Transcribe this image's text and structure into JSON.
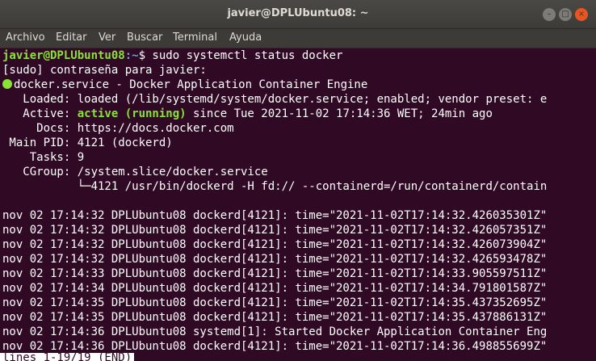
{
  "window": {
    "title": "javier@DPLUbuntu08: ~",
    "min_glyph": "–",
    "max_glyph": "□",
    "close_glyph": "×"
  },
  "menu": [
    "Archivo",
    "Editar",
    "Ver",
    "Buscar",
    "Terminal",
    "Ayuda"
  ],
  "terminal": {
    "prompt_user": "javier@DPLUbuntu08",
    "prompt_path": ":~",
    "prompt_cmd": "$ sudo systemctl status docker",
    "sudo_prompt": "[sudo] contraseña para javier:",
    "service_line": "docker.service - Docker Application Container Engine",
    "loaded": "   Loaded: loaded (/lib/systemd/system/docker.service; enabled; vendor preset: e",
    "active_label": "   Active: ",
    "active_status": "active (running)",
    "active_since": " since Tue 2021-11-02 17:14:36 WET; 24min ago",
    "docs": "     Docs: https://docs.docker.com",
    "main_pid": " Main PID: 4121 (dockerd)",
    "tasks": "    Tasks: 9",
    "cgroup": "   CGroup: /system.slice/docker.service",
    "cgroup_child": "           └─4121 /usr/bin/dockerd -H fd:// --containerd=/run/containerd/contain",
    "logs": [
      "nov 02 17:14:32 DPLUbuntu08 dockerd[4121]: time=\"2021-11-02T17:14:32.426035301Z\"",
      "nov 02 17:14:32 DPLUbuntu08 dockerd[4121]: time=\"2021-11-02T17:14:32.426057351Z\"",
      "nov 02 17:14:32 DPLUbuntu08 dockerd[4121]: time=\"2021-11-02T17:14:32.426073904Z\"",
      "nov 02 17:14:32 DPLUbuntu08 dockerd[4121]: time=\"2021-11-02T17:14:32.426593478Z\"",
      "nov 02 17:14:33 DPLUbuntu08 dockerd[4121]: time=\"2021-11-02T17:14:33.905597511Z\"",
      "nov 02 17:14:34 DPLUbuntu08 dockerd[4121]: time=\"2021-11-02T17:14:34.791801587Z\"",
      "nov 02 17:14:35 DPLUbuntu08 dockerd[4121]: time=\"2021-11-02T17:14:35.437352695Z\"",
      "nov 02 17:14:35 DPLUbuntu08 dockerd[4121]: time=\"2021-11-02T17:14:35.437886131Z\"",
      "nov 02 17:14:36 DPLUbuntu08 systemd[1]: Started Docker Application Container Eng",
      "nov 02 17:14:36 DPLUbuntu08 dockerd[4121]: time=\"2021-11-02T17:14:36.498855699Z\""
    ],
    "pager_status": "lines 1-19/19 (END)"
  },
  "colors": {
    "terminal_bg": "#300a24",
    "prompt_user": "#8ae234",
    "prompt_path": "#729fcf",
    "active": "#8ae234",
    "close_button": "#e95420"
  }
}
